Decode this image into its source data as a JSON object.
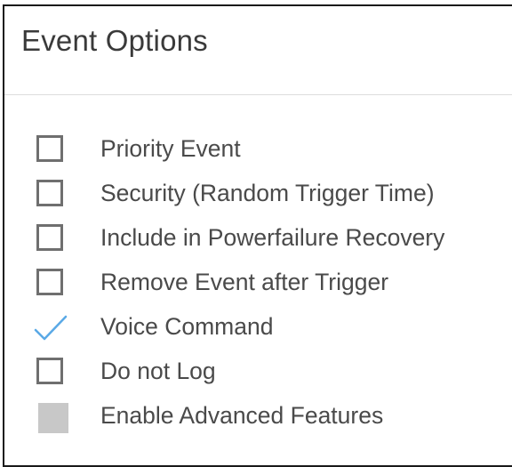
{
  "panel": {
    "title": "Event Options"
  },
  "options": [
    {
      "label": "Priority Event",
      "checked": false,
      "disabled": false
    },
    {
      "label": "Security (Random Trigger Time)",
      "checked": false,
      "disabled": false
    },
    {
      "label": "Include in Powerfailure Recovery",
      "checked": false,
      "disabled": false
    },
    {
      "label": "Remove Event after Trigger",
      "checked": false,
      "disabled": false
    },
    {
      "label": "Voice Command",
      "checked": true,
      "disabled": false
    },
    {
      "label": "Do not Log",
      "checked": false,
      "disabled": false
    },
    {
      "label": "Enable Advanced Features",
      "checked": false,
      "disabled": true
    }
  ],
  "colors": {
    "checkmark": "#5aa9e6",
    "checkbox_border": "#6f6f6f",
    "disabled_fill": "#c8c8c8",
    "label_text": "#4a4a4a"
  }
}
